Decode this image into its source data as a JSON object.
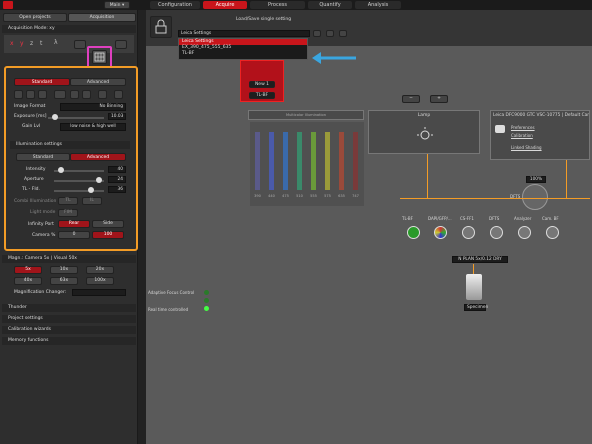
{
  "topbar": {
    "main_label": "Main",
    "tabs": [
      "Configuration",
      "Acquire",
      "Process",
      "Quantify",
      "Analysis"
    ],
    "active_tab": "Acquire"
  },
  "left": {
    "tabs": [
      "Open projects",
      "Acquisition"
    ],
    "acq_mode_label": "Acquisition Mode: xy",
    "axes": [
      "x",
      "y",
      "z",
      "t",
      "λ"
    ],
    "mode_tabs": [
      "Standard",
      "Advanced"
    ],
    "image_format_label": "Image Format",
    "image_format_value": "No Binning",
    "exposure_label": "Exposure [ms]",
    "exposure_value": "10.03",
    "gain_label": "Gain Lvl",
    "gain_value": "low noise & high well",
    "illum_header": "Illumination settings",
    "illum_tabs": [
      "Standard",
      "Advanced"
    ],
    "intensity_label": "Intensity",
    "intensity_value": "40",
    "aperture_label": "Aperture",
    "aperture_value": "24",
    "tlfd_label": "TL - FId.",
    "tlfd_value": "36",
    "combi_label": "Combi Illumination",
    "combi_opts": [
      "TL",
      "IL"
    ],
    "light_mode_label": "Light mode",
    "light_mode_value": "FIM",
    "infinity_label": "Infinity Port",
    "infinity_opts": [
      "Rear",
      "Side"
    ],
    "camera_label": "Camera %",
    "camera_opts": [
      "0",
      "100"
    ],
    "magn_header": "Magn.: Camera 5x | Visual 50x",
    "magn_opts": [
      "5x",
      "10x",
      "20x",
      "40x",
      "63x",
      "100x"
    ],
    "magn_changer_label": "Magnification Changer:",
    "sections": [
      "Thunder",
      "Project settings",
      "Calibration wizards",
      "Memory functions"
    ]
  },
  "workspace": {
    "load_save_label": "Load/Save single setting",
    "dropdown_selected": "Leica Settings",
    "dropdown_items": [
      "Leica Settings",
      "EX_390_475_555_635",
      "TL-BF"
    ],
    "multicolor_label": "Multicolor Illumination",
    "channels": [
      "390",
      "440",
      "475",
      "510",
      "555",
      "575",
      "635",
      "747"
    ],
    "lamp_label": "Lamp",
    "camera_title": "Leica DFC9000 GTC VSC-10775 | Default Camera",
    "camera_links": [
      "Preferences",
      "Calibration",
      "Linked Shading"
    ],
    "dfts_label": "DFTS",
    "dfts_value": "100%",
    "new_label": "New 1",
    "tl_bf_label": "TL-BF",
    "minus": "−",
    "plus": "+",
    "filter_labels": [
      "TL-BF",
      "DAPI/GFP/...",
      "CS-FF1",
      "DFTS",
      "Analyzer",
      "Cam. BF"
    ],
    "objective_label": "N PLAN  5x/0.12 DRY",
    "specimen_label": "Specimen",
    "afc_label": "Adaptive Focus Control",
    "rt_label": "Real time controlled"
  },
  "colors": {
    "accent": "#c8151b",
    "highlight": "#f39c26",
    "callout": "#e040c0",
    "arrow": "#3aa6e0"
  }
}
